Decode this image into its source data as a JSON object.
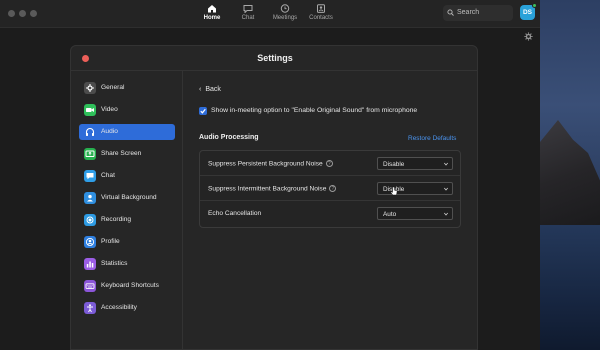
{
  "topnav": {
    "tabs": [
      {
        "label": "Home",
        "icon": "home-icon",
        "active": true
      },
      {
        "label": "Chat",
        "icon": "chat-icon",
        "active": false
      },
      {
        "label": "Meetings",
        "icon": "clock-icon",
        "active": false
      },
      {
        "label": "Contacts",
        "icon": "contacts-icon",
        "active": false
      }
    ],
    "search_placeholder": "Search",
    "avatar_initials": "DS"
  },
  "settings": {
    "title": "Settings",
    "sidebar": [
      {
        "label": "General",
        "color": "#4c4c4c",
        "icon": "gear-icon"
      },
      {
        "label": "Video",
        "color": "#2fbf5a",
        "icon": "video-icon"
      },
      {
        "label": "Audio",
        "color": "#2e6cd9",
        "icon": "headphones-icon",
        "active": true
      },
      {
        "label": "Share Screen",
        "color": "#27b14f",
        "icon": "share-screen-icon"
      },
      {
        "label": "Chat",
        "color": "#2f9ee8",
        "icon": "chat-icon"
      },
      {
        "label": "Virtual Background",
        "color": "#2f8fe0",
        "icon": "person-icon"
      },
      {
        "label": "Recording",
        "color": "#2d9be3",
        "icon": "record-icon"
      },
      {
        "label": "Profile",
        "color": "#2e7fe0",
        "icon": "profile-icon"
      },
      {
        "label": "Statistics",
        "color": "#9b5de5",
        "icon": "stats-icon"
      },
      {
        "label": "Keyboard Shortcuts",
        "color": "#8b55d8",
        "icon": "keyboard-icon"
      },
      {
        "label": "Accessibility",
        "color": "#7b5bd6",
        "icon": "accessibility-icon"
      }
    ],
    "back_label": "Back",
    "original_sound_checkbox": {
      "label": "Show in-meeting option to \"Enable Original Sound\" from microphone",
      "checked": true
    },
    "audio_processing": {
      "title": "Audio Processing",
      "restore_label": "Restore Defaults",
      "rows": [
        {
          "label": "Suppress Persistent Background Noise",
          "value": "Disable",
          "help": "?"
        },
        {
          "label": "Suppress Intermittent Background Noise",
          "value": "Disable",
          "help": "?"
        },
        {
          "label": "Echo Cancellation",
          "value": "Auto",
          "help": ""
        }
      ]
    }
  },
  "colors": {
    "accent": "#2e6cd9",
    "link": "#4a94f0",
    "close": "#ec5f59",
    "avatar": "#2aa2d9",
    "online": "#3ec15b"
  }
}
